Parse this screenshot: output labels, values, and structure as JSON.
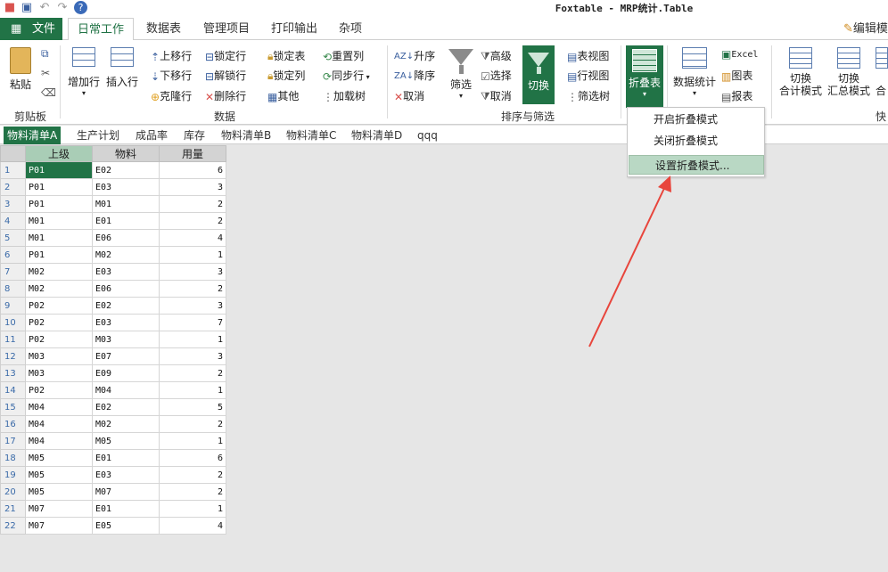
{
  "window": {
    "title": "Foxtable - MRP统计.Table"
  },
  "menu": {
    "file": "文件",
    "tabs": [
      "日常工作",
      "数据表",
      "管理项目",
      "打印输出",
      "杂项"
    ],
    "right_button": "编辑模"
  },
  "ribbon": {
    "clipboard": {
      "label": "剪贴板",
      "paste": "粘贴"
    },
    "data": {
      "label": "数据",
      "add_row": "增加行",
      "insert_row": "插入行",
      "move_up": "上移行",
      "move_down": "下移行",
      "clone_row": "克隆行",
      "lock_row": "锁定行",
      "unlock_row": "解锁行",
      "delete_row": "删除行",
      "lock_table": "锁定表",
      "lock_col": "锁定列",
      "other": "其他",
      "reset_col": "重置列",
      "sync_row": "同步行",
      "load_tree": "加载树"
    },
    "sort_filter": {
      "label": "排序与筛选",
      "asc": "升序",
      "desc": "降序",
      "cancel": "取消",
      "filter": "筛选",
      "advanced": "高级",
      "select": "选择",
      "cancel2": "取消",
      "switch": "切换",
      "table_view": "表视图",
      "row_view": "行视图",
      "filter_tree": "筛选树"
    },
    "fold": {
      "fold_table": "折叠表"
    },
    "stats": {
      "data_stats": "数据统计",
      "excel": "Excel",
      "chart": "图表",
      "report": "报表"
    },
    "quick": {
      "label": "快",
      "switch_total_1": "切换",
      "switch_total_2": "合计模式",
      "switch_summary_1": "切换",
      "switch_summary_2": "汇总模式",
      "partial": "合"
    }
  },
  "dropdown": {
    "items": [
      "开启折叠模式",
      "关闭折叠模式",
      "设置折叠模式..."
    ],
    "highlighted_index": 2
  },
  "sheet_tabs": [
    "物料清单A",
    "生产计划",
    "成品率",
    "库存",
    "物料清单B",
    "物料清单C",
    "物料清单D",
    "qqq"
  ],
  "grid": {
    "columns": [
      "上级",
      "物料",
      "用量"
    ],
    "rows": [
      [
        "P01",
        "E02",
        "6"
      ],
      [
        "P01",
        "E03",
        "3"
      ],
      [
        "P01",
        "M01",
        "2"
      ],
      [
        "M01",
        "E01",
        "2"
      ],
      [
        "M01",
        "E06",
        "4"
      ],
      [
        "P01",
        "M02",
        "1"
      ],
      [
        "M02",
        "E03",
        "3"
      ],
      [
        "M02",
        "E06",
        "2"
      ],
      [
        "P02",
        "E02",
        "3"
      ],
      [
        "P02",
        "E03",
        "7"
      ],
      [
        "P02",
        "M03",
        "1"
      ],
      [
        "M03",
        "E07",
        "3"
      ],
      [
        "M03",
        "E09",
        "2"
      ],
      [
        "P02",
        "M04",
        "1"
      ],
      [
        "M04",
        "E02",
        "5"
      ],
      [
        "M04",
        "M02",
        "2"
      ],
      [
        "M04",
        "M05",
        "1"
      ],
      [
        "M05",
        "E01",
        "6"
      ],
      [
        "M05",
        "E03",
        "2"
      ],
      [
        "M05",
        "M07",
        "2"
      ],
      [
        "M07",
        "E01",
        "1"
      ],
      [
        "M07",
        "E05",
        "4"
      ]
    ]
  },
  "colors": {
    "accent": "#217346",
    "highlight": "#b9d8c4",
    "arrow": "#e8453c"
  }
}
